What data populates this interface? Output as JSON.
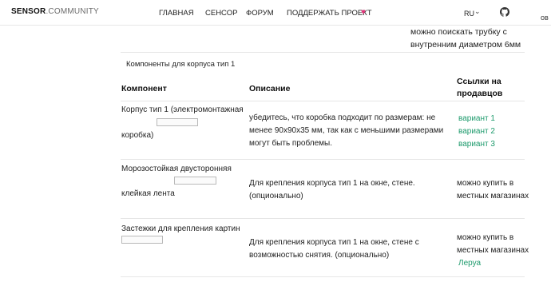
{
  "header": {
    "logo_bold": "SENSOR",
    "logo_light": ".COMMUNITY",
    "nav": [
      "ГЛАВНАЯ",
      "СЕНСОР",
      "ФОРУМ",
      "ПОДДЕРЖАТЬ ПРОЕКТ"
    ],
    "lang": "RU",
    "overflow_text": "ов"
  },
  "prev_row": {
    "text_line1": "можно поискать трубку с",
    "text_line2": "внутренним диаметром 6мм"
  },
  "table": {
    "caption": "Компоненты для корпуса тип 1",
    "headers": [
      "Компонент",
      "Описание",
      "Ссылки на",
      "продавцов"
    ],
    "rows": [
      {
        "component_line1": "Корпус тип 1 (электромонтажная",
        "component_line2": "коробка)",
        "desc_line1": "убедитесь, что коробка подходит по размерам: не",
        "desc_line2": "менее 90x90x35 мм, так как с меньшими размерами",
        "desc_line3": "могут быть проблемы.",
        "links": [
          "вариант 1",
          "вариант 2",
          "вариант 3"
        ]
      },
      {
        "component_line1": "Морозостойкая двусторонняя",
        "component_line2": "клейкая лента",
        "desc_line1": "Для крепления корпуса тип 1 на окне, стене.",
        "desc_line2": "(опционально)",
        "seller_line1": "можно купить в",
        "seller_line2": "местных магазинах"
      },
      {
        "component_line1": "Застежки для крепления картин",
        "desc_line1": "Для крепления корпуса тип 1 на окне, стене с",
        "desc_line2": "возможностью снятия. (опционально)",
        "seller_line1": "можно купить в",
        "seller_line2": "местных магазинах",
        "seller_link": "Леруа"
      }
    ]
  },
  "colors": {
    "accent": "#1d9a6c",
    "heart": "#e3347a"
  }
}
